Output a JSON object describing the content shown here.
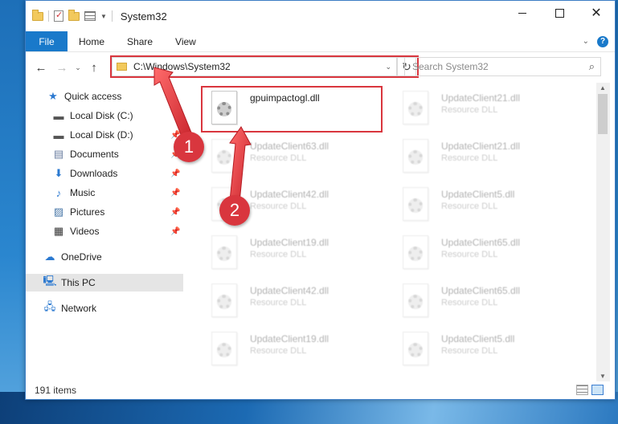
{
  "window": {
    "title": "System32"
  },
  "ribbon": {
    "tab_file": "File",
    "tab_home": "Home",
    "tab_share": "Share",
    "tab_view": "View"
  },
  "nav": {
    "address": "C:\\Windows\\System32",
    "search_placeholder": "Search System32"
  },
  "sidebar": {
    "items": [
      {
        "label": "Quick access",
        "icon": "star-icon"
      },
      {
        "label": "Local Disk (C:)",
        "icon": "drive-icon"
      },
      {
        "label": "Local Disk (D:)",
        "icon": "drive-icon"
      },
      {
        "label": "Documents",
        "icon": "documents-icon"
      },
      {
        "label": "Downloads",
        "icon": "download-icon"
      },
      {
        "label": "Music",
        "icon": "music-icon"
      },
      {
        "label": "Pictures",
        "icon": "pictures-icon"
      },
      {
        "label": "Videos",
        "icon": "videos-icon"
      },
      {
        "label": "OneDrive",
        "icon": "cloud-icon"
      },
      {
        "label": "This PC",
        "icon": "pc-icon"
      },
      {
        "label": "Network",
        "icon": "network-icon"
      }
    ]
  },
  "files": {
    "items": [
      {
        "name": "gpuimpactogl.dll",
        "type": ""
      },
      {
        "name": "UpdateClient21.dll",
        "type": "Resource DLL"
      },
      {
        "name": "UpdateClient63.dll",
        "type": "Resource DLL"
      },
      {
        "name": "UpdateClient21.dll",
        "type": "Resource DLL"
      },
      {
        "name": "UpdateClient42.dll",
        "type": "Resource DLL"
      },
      {
        "name": "UpdateClient5.dll",
        "type": "Resource DLL"
      },
      {
        "name": "UpdateClient19.dll",
        "type": "Resource DLL"
      },
      {
        "name": "UpdateClient65.dll",
        "type": "Resource DLL"
      },
      {
        "name": "UpdateClient42.dll",
        "type": "Resource DLL"
      },
      {
        "name": "UpdateClient65.dll",
        "type": "Resource DLL"
      },
      {
        "name": "UpdateClient19.dll",
        "type": "Resource DLL"
      },
      {
        "name": "UpdateClient5.dll",
        "type": "Resource DLL"
      }
    ]
  },
  "status": {
    "item_count": "191 items"
  },
  "callouts": {
    "one": "1",
    "two": "2"
  },
  "colors": {
    "accent": "#1979ca",
    "highlight": "#d9363e"
  }
}
